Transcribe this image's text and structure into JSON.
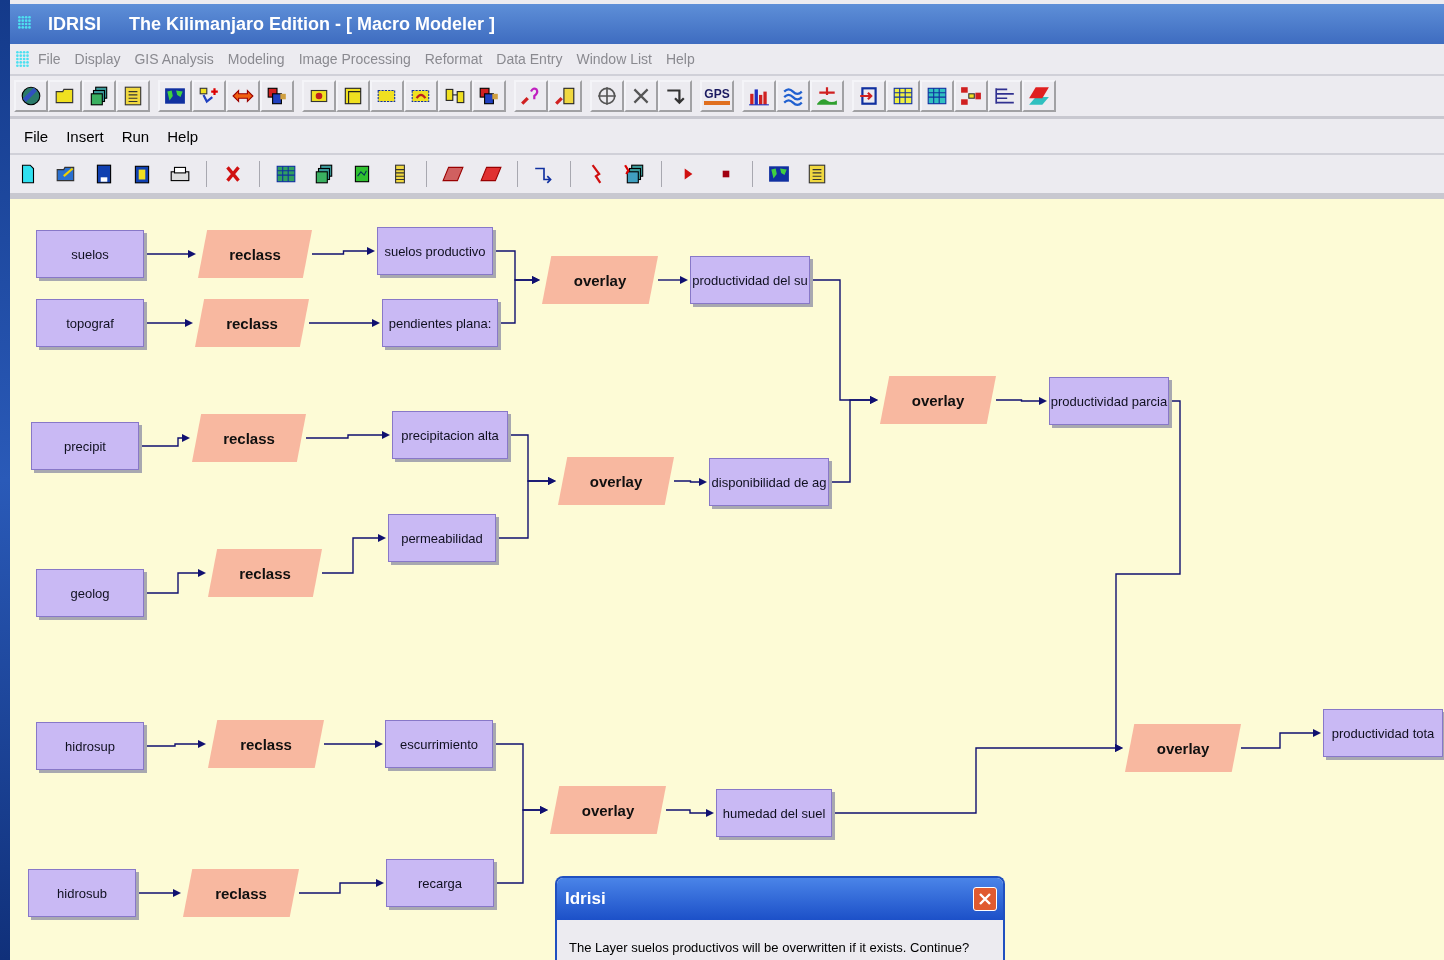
{
  "window": {
    "app": "IDRISI",
    "title": "The Kilimanjaro Edition - [ Macro Modeler ]"
  },
  "main_menu": [
    {
      "label": "File",
      "disabled": true
    },
    {
      "label": "Display",
      "disabled": true
    },
    {
      "label": "GIS Analysis",
      "disabled": true
    },
    {
      "label": "Modeling",
      "disabled": true
    },
    {
      "label": "Image Processing",
      "disabled": true
    },
    {
      "label": "Reformat",
      "disabled": true
    },
    {
      "label": "Data Entry",
      "disabled": true
    },
    {
      "label": "Window List",
      "disabled": true
    },
    {
      "label": "Help",
      "disabled": true
    }
  ],
  "main_toolbar": {
    "gps_label": "GPS"
  },
  "modeler_menu": [
    "File",
    "Insert",
    "Run",
    "Help"
  ],
  "diagram": {
    "nodes": [
      {
        "kind": "layer",
        "label": "suelos"
      },
      {
        "kind": "module",
        "label": "reclass"
      },
      {
        "kind": "layer",
        "label": "suelos productivo"
      },
      {
        "kind": "layer",
        "label": "topograf"
      },
      {
        "kind": "module",
        "label": "reclass"
      },
      {
        "kind": "layer",
        "label": "pendientes plana:"
      },
      {
        "kind": "module",
        "label": "overlay"
      },
      {
        "kind": "layer",
        "label": "productividad del su"
      },
      {
        "kind": "layer",
        "label": "precipit"
      },
      {
        "kind": "module",
        "label": "reclass"
      },
      {
        "kind": "layer",
        "label": "precipitacion alta"
      },
      {
        "kind": "layer",
        "label": "permeabilidad"
      },
      {
        "kind": "layer",
        "label": "geolog"
      },
      {
        "kind": "module",
        "label": "reclass"
      },
      {
        "kind": "module",
        "label": "overlay"
      },
      {
        "kind": "layer",
        "label": "disponibilidad de ag"
      },
      {
        "kind": "module",
        "label": "overlay"
      },
      {
        "kind": "layer",
        "label": "productividad parcia"
      },
      {
        "kind": "layer",
        "label": "hidrosup"
      },
      {
        "kind": "module",
        "label": "reclass"
      },
      {
        "kind": "layer",
        "label": "escurrimiento"
      },
      {
        "kind": "layer",
        "label": "hidrosub"
      },
      {
        "kind": "module",
        "label": "reclass"
      },
      {
        "kind": "layer",
        "label": "recarga"
      },
      {
        "kind": "module",
        "label": "overlay"
      },
      {
        "kind": "layer",
        "label": "humedad del suel"
      },
      {
        "kind": "module",
        "label": "overlay"
      },
      {
        "kind": "layer",
        "label": "productividad tota"
      }
    ]
  },
  "dialog": {
    "title": "Idrisi",
    "message": "The Layer suelos productivos will be overwritten if it exists. Continue?"
  }
}
